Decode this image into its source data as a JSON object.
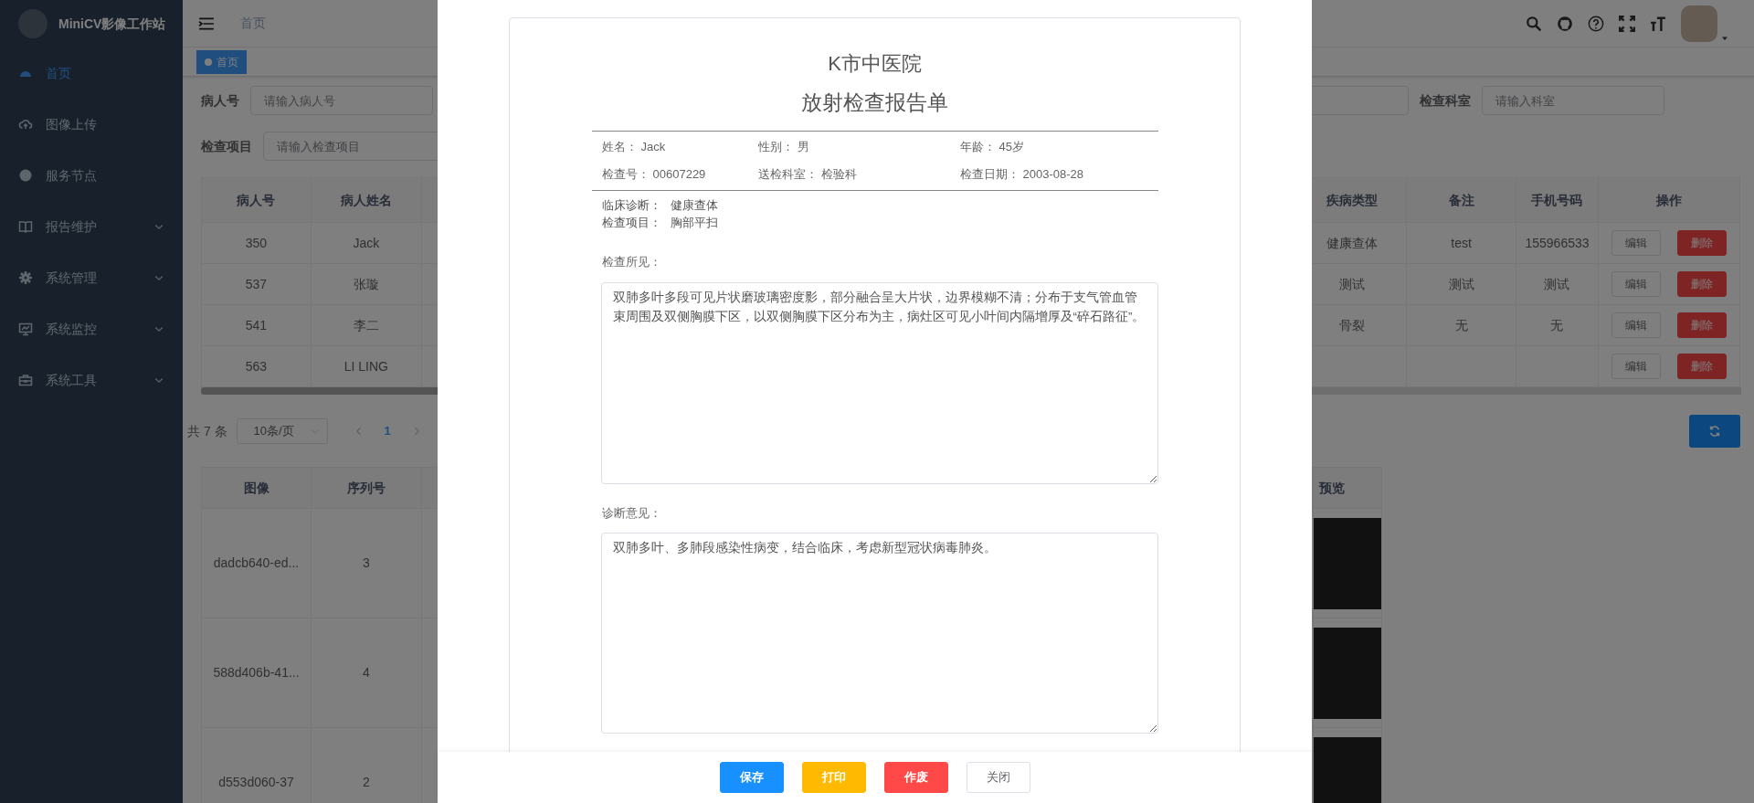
{
  "sidebar": {
    "title": "MiniCV影像工作站",
    "items": [
      {
        "label": "首页",
        "selected": true,
        "has_submenu": false
      },
      {
        "label": "图像上传",
        "selected": false,
        "has_submenu": false
      },
      {
        "label": "服务节点",
        "selected": false,
        "has_submenu": false
      },
      {
        "label": "报告维护",
        "selected": false,
        "has_submenu": true
      },
      {
        "label": "系统管理",
        "selected": false,
        "has_submenu": true
      },
      {
        "label": "系统监控",
        "selected": false,
        "has_submenu": true
      },
      {
        "label": "系统工具",
        "selected": false,
        "has_submenu": true
      }
    ]
  },
  "header": {
    "breadcrumb": "首页"
  },
  "tags": [
    {
      "label": "首页",
      "selected": true
    }
  ],
  "filters": {
    "rows": [
      {
        "start": [
          {
            "kind": "labeled",
            "label": "病人号",
            "placeholder": "请输入病人号"
          }
        ],
        "end": [
          {
            "kind": "bare"
          },
          {
            "kind": "labeled",
            "label": "检查科室",
            "placeholder": "请输入科室"
          }
        ]
      },
      {
        "start": [
          {
            "kind": "labeled",
            "label": "检查项目",
            "placeholder": "请输入检查项目"
          }
        ]
      }
    ]
  },
  "patient_table": {
    "columns": [
      "病人号",
      "病人姓名",
      "疾病类型",
      "备注",
      "手机号码",
      "操作"
    ],
    "rows": [
      {
        "cells": [
          "350",
          "Jack",
          "健康查体",
          "test",
          "155966533"
        ],
        "actions": [
          "编辑",
          "删除"
        ]
      },
      {
        "cells": [
          "537",
          "张璇",
          "测试",
          "测试",
          "测试"
        ],
        "actions": [
          "编辑",
          "删除"
        ]
      },
      {
        "cells": [
          "541",
          "李二",
          "骨裂",
          "无",
          "无"
        ],
        "actions": [
          "编辑",
          "删除"
        ]
      },
      {
        "cells": [
          "563",
          "LI LING"
        ],
        "actions": [
          "编辑",
          "删除"
        ]
      }
    ]
  },
  "pagination": {
    "total": "共 7 条",
    "page_size": "10条/页",
    "pages": [
      {
        "label": "1",
        "selected": true
      }
    ]
  },
  "image_table": {
    "columns": [
      "图像",
      "序列号",
      "预览"
    ],
    "rows": [
      {
        "cells": [
          "dadcb640-ed...",
          "3"
        ]
      },
      {
        "cells": [
          "588d406b-41...",
          "4"
        ]
      },
      {
        "cells": [
          "d553d060-37",
          "2"
        ]
      }
    ]
  },
  "report_dialog": {
    "hospital": "K市中医院",
    "title": "放射检查报告单",
    "info": [
      [
        {
          "label": "姓名：",
          "value": "Jack"
        },
        {
          "label": "性别：",
          "value": "男"
        },
        {
          "label": "年龄：",
          "value": "45岁"
        }
      ],
      [
        {
          "label": "检查号：",
          "value": "00607229"
        },
        {
          "label": "送检科室：",
          "value": "检验科"
        },
        {
          "label": "检查日期：",
          "value": "2003-08-28"
        }
      ]
    ],
    "clinical": [
      {
        "label": "临床诊断：",
        "value": "健康查体"
      },
      {
        "label": "检查项目：",
        "value": "胸部平扫"
      }
    ],
    "findings": {
      "label": "检查所见：",
      "value": "双肺多叶多段可见片状磨玻璃密度影，部分融合呈大片状，边界模糊不清；分布于支气管血管束周围及双侧胸膜下区，以双侧胸膜下区分布为主，病灶区可见小叶间内隔增厚及“碎石路征”。"
    },
    "diagnosis": {
      "label": "诊断意见：",
      "value": "双肺多叶、多肺段感染性病变，结合临床，考虑新型冠状病毒肺炎。"
    },
    "buttons": [
      {
        "label": "保存",
        "kind": "primary"
      },
      {
        "label": "打印",
        "kind": "warning"
      },
      {
        "label": "作废",
        "kind": "danger"
      },
      {
        "label": "关闭",
        "kind": "default"
      }
    ]
  }
}
